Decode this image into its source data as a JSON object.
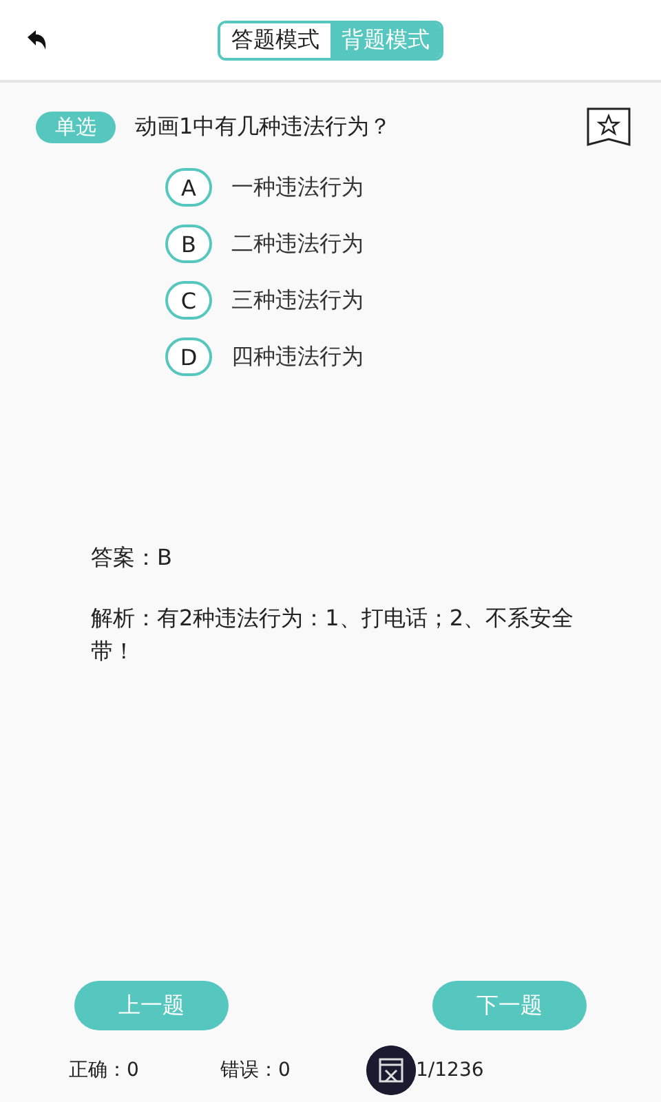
{
  "mode_tabs": [
    {
      "label": "答题模式",
      "selected": false
    },
    {
      "label": "背题模式",
      "selected": true
    }
  ],
  "question": {
    "type_tag": "单选",
    "text": "动画1中有几种违法行为？",
    "favorited": false
  },
  "options": [
    {
      "letter": "A",
      "text": "一种违法行为"
    },
    {
      "letter": "B",
      "text": "二种违法行为"
    },
    {
      "letter": "C",
      "text": "三种违法行为"
    },
    {
      "letter": "D",
      "text": "四种违法行为"
    }
  ],
  "answer": "答案：B",
  "analysis": "解析：有2种违法行为：1、打电话；2、不系安全带！",
  "buttons": {
    "prev": "上一题",
    "next": "下一题"
  },
  "footer": {
    "correct": "正确：0",
    "wrong": "错误：0",
    "progress": "1/1236"
  }
}
